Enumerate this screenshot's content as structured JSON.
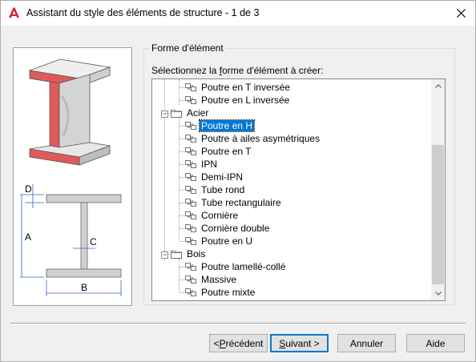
{
  "window": {
    "title": "Assistant du style des éléments de structure - 1 de 3",
    "close_glyph": "✕"
  },
  "diagram": {
    "label_d": "D",
    "label_a": "A",
    "label_c": "C",
    "label_b": "B"
  },
  "group": {
    "title": "Forme d'élément",
    "tree_label_prefix": "Sélectionnez la ",
    "tree_label_accel": "f",
    "tree_label_suffix": "orme d'élément à créer:"
  },
  "tree": {
    "items": [
      {
        "label": "Poutre en T inversée",
        "type": "item"
      },
      {
        "label": "Poutre en L inversée",
        "type": "item"
      },
      {
        "label": "Acier",
        "type": "folder"
      },
      {
        "label": "Poutre en H",
        "type": "item",
        "selected": true
      },
      {
        "label": "Poutre à ailes asymétriques",
        "type": "item"
      },
      {
        "label": "Poutre en T",
        "type": "item"
      },
      {
        "label": "IPN",
        "type": "item"
      },
      {
        "label": "Demi-IPN",
        "type": "item"
      },
      {
        "label": "Tube rond",
        "type": "item"
      },
      {
        "label": "Tube rectangulaire",
        "type": "item"
      },
      {
        "label": "Cornière",
        "type": "item"
      },
      {
        "label": "Cornière double",
        "type": "item"
      },
      {
        "label": "Poutre en U",
        "type": "item"
      },
      {
        "label": "Bois",
        "type": "folder"
      },
      {
        "label": "Poutre lamellé-collé",
        "type": "item"
      },
      {
        "label": "Massive",
        "type": "item"
      },
      {
        "label": "Poutre mixte",
        "type": "item"
      }
    ],
    "expander_glyph": "−"
  },
  "buttons": {
    "back_prefix": "< ",
    "back_accel": "P",
    "back_suffix": "récédent",
    "next_accel": "S",
    "next_suffix": "uivant >",
    "cancel": "Annuler",
    "help": "Aide"
  },
  "colors": {
    "accent": "#0078d7",
    "flange_red": "#e05a5a",
    "dimension_blue": "#3060d0"
  }
}
